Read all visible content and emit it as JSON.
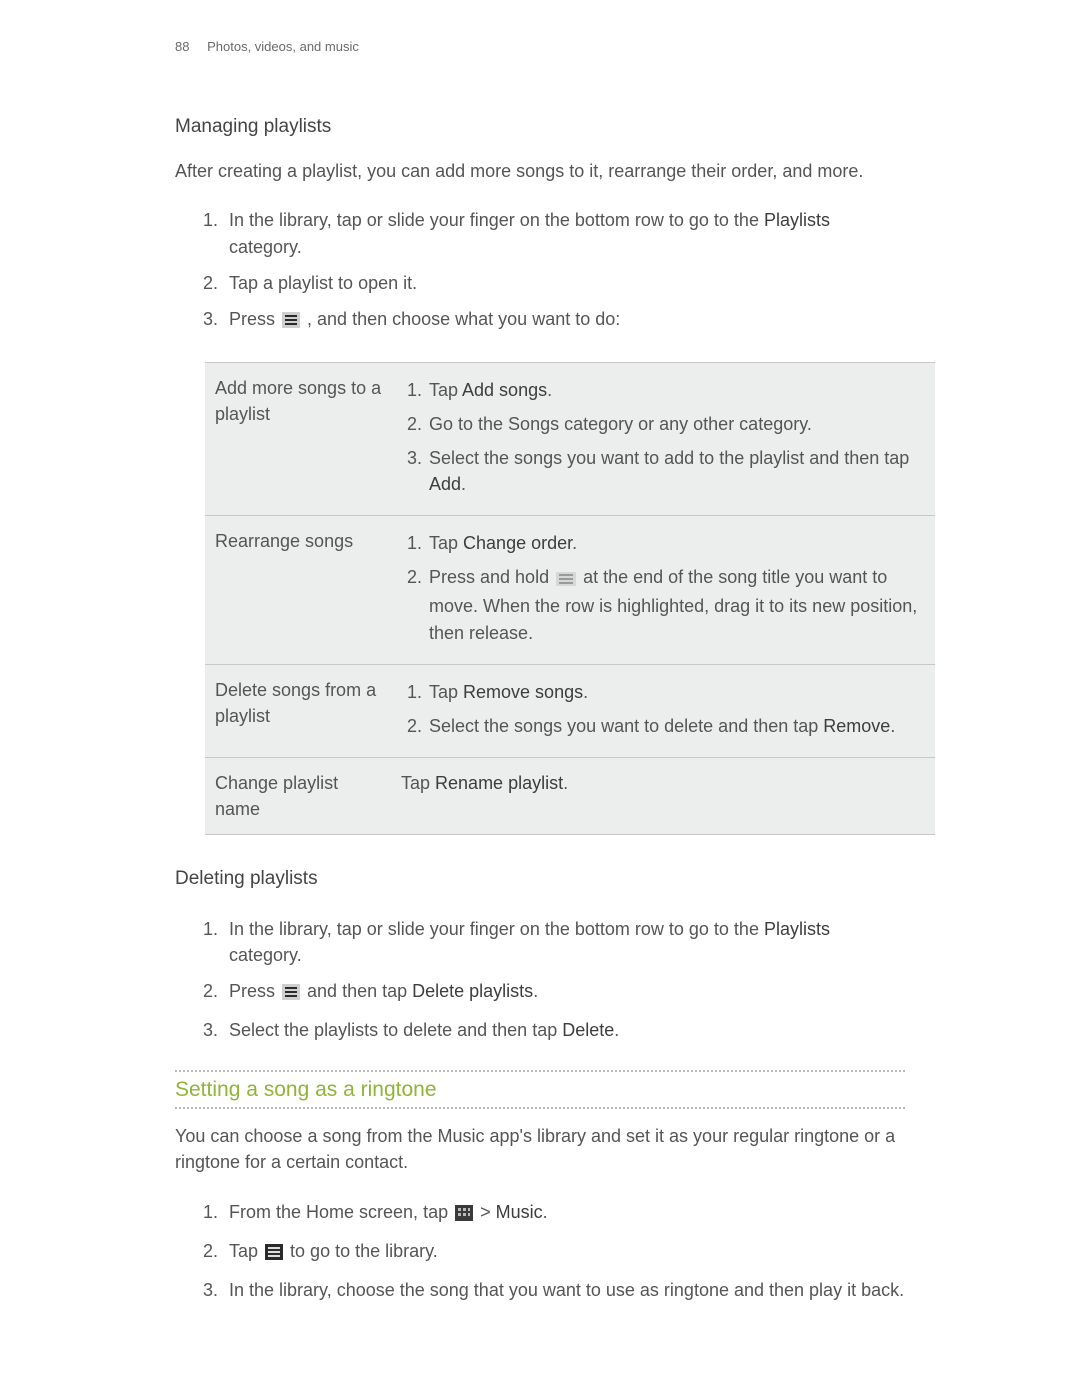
{
  "header": {
    "pageNumber": "88",
    "chapter": "Photos, videos, and music"
  },
  "managing": {
    "heading": "Managing playlists",
    "intro": "After creating a playlist, you can add more songs to it, rearrange their order, and more.",
    "step1_a": "In the library, tap or slide your finger on the bottom row to go to the ",
    "step1_bold": "Playlists",
    "step1_b": " category.",
    "step2": "Tap a playlist to open it.",
    "step3_a": "Press ",
    "step3_b": " , and then choose what you want to do:"
  },
  "optionsTable": {
    "row1": {
      "label": "Add more songs to a playlist",
      "s1_a": "Tap ",
      "s1_bold": "Add songs",
      "s1_b": ".",
      "s2": "Go to the Songs category or any other category.",
      "s3_a": "Select the songs you want to add to the playlist and then tap ",
      "s3_bold": "Add",
      "s3_b": "."
    },
    "row2": {
      "label": "Rearrange songs",
      "s1_a": "Tap ",
      "s1_bold": "Change order",
      "s1_b": ".",
      "s2_a": "Press and hold ",
      "s2_b": " at the end of the song title you want to move. When the row is highlighted, drag it to its new position, then release."
    },
    "row3": {
      "label": "Delete songs from a playlist",
      "s1_a": "Tap ",
      "s1_bold": "Remove songs",
      "s1_b": ".",
      "s2_a": "Select the songs you want to delete and then tap ",
      "s2_bold": "Remove",
      "s2_b": "."
    },
    "row4": {
      "label": "Change playlist name",
      "text_a": "Tap ",
      "text_bold": "Rename playlist",
      "text_b": "."
    }
  },
  "deleting": {
    "heading": "Deleting playlists",
    "step1_a": "In the library, tap or slide your finger on the bottom row to go to the ",
    "step1_bold": "Playlists",
    "step1_b": " category.",
    "step2_a": "Press ",
    "step2_b": " and then tap ",
    "step2_bold": "Delete playlists",
    "step2_c": ".",
    "step3_a": "Select the playlists to delete and then tap ",
    "step3_bold": "Delete",
    "step3_b": "."
  },
  "ringtone": {
    "title": "Setting a song as a ringtone",
    "intro": "You can choose a song from the Music app's library and set it as your regular ringtone or a ringtone for a certain contact.",
    "step1_a": "From the Home screen, tap ",
    "step1_b": " > ",
    "step1_bold": "Music",
    "step1_c": ".",
    "step2_a": "Tap ",
    "step2_b": " to go to the library.",
    "step3": "In the library, choose the song that you want to use as ringtone and then play it back."
  }
}
